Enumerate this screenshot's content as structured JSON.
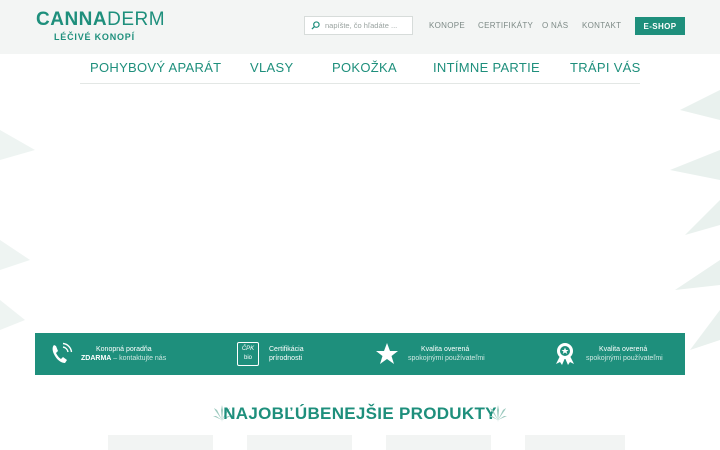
{
  "logo": {
    "part1": "CANNA",
    "part2": "DERM",
    "tagline": "LÉČIVÉ KONOPÍ"
  },
  "search": {
    "placeholder": "napíšte, čo hľadáte ..."
  },
  "topnav": [
    {
      "label": "KONOPE"
    },
    {
      "label": "CERTIFIKÁTY"
    },
    {
      "label": "O NÁS"
    },
    {
      "label": "KONTAKT"
    }
  ],
  "eshop_label": "E-SHOP",
  "categories": [
    {
      "label": "POHYBOVÝ APARÁT"
    },
    {
      "label": "VLASY"
    },
    {
      "label": "POKOŽKA"
    },
    {
      "label": "INTÍMNE PARTIE"
    },
    {
      "label": "TRÁPI VÁS"
    }
  ],
  "features": [
    {
      "icon": "phone-icon",
      "line1": "Konopná poradňa",
      "line2_bold": "ZDARMA",
      "line2_rest": " – kontaktujte nás"
    },
    {
      "icon": "bio-certificate-icon",
      "icon_text_top": "ČPK",
      "icon_text_bottom": "bio",
      "line1": "Certifikácia",
      "line2": "prírodnosti"
    },
    {
      "icon": "star-icon",
      "line1": "Kvalita overená",
      "line2": "spokojnými používateľmi"
    },
    {
      "icon": "award-ribbon-icon",
      "line1": "Kvalita overená",
      "line2": "spokojnými používateľmi"
    }
  ],
  "products_heading": "NAJOBĽÚBENEJŠIE PRODUKTY",
  "colors": {
    "brand": "#1e8f7c",
    "header_bg": "#f3f5f4",
    "leaf": "#e6efec"
  }
}
